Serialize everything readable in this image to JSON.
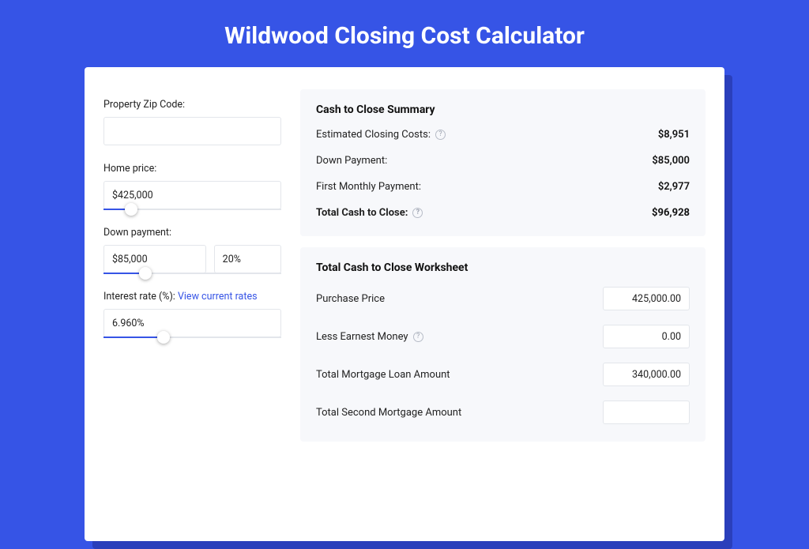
{
  "title": "Wildwood Closing Cost Calculator",
  "form": {
    "zip_label": "Property Zip Code:",
    "zip_value": "",
    "home_price_label": "Home price:",
    "home_price_value": "$425,000",
    "home_price_pct": 12,
    "down_payment_label": "Down payment:",
    "down_payment_value": "$85,000",
    "down_payment_pct_value": "20%",
    "down_payment_slider_pct": 20,
    "interest_label": "Interest rate (%): ",
    "interest_link": "View current rates",
    "interest_value": "6.960%",
    "interest_slider_pct": 30
  },
  "summary": {
    "heading": "Cash to Close Summary",
    "rows": [
      {
        "label": "Estimated Closing Costs:",
        "help": true,
        "value": "$8,951"
      },
      {
        "label": "Down Payment:",
        "help": false,
        "value": "$85,000"
      },
      {
        "label": "First Monthly Payment:",
        "help": false,
        "value": "$2,977"
      }
    ],
    "total": {
      "label": "Total Cash to Close:",
      "help": true,
      "value": "$96,928"
    }
  },
  "worksheet": {
    "heading": "Total Cash to Close Worksheet",
    "rows": [
      {
        "label": "Purchase Price",
        "help": false,
        "value": "425,000.00"
      },
      {
        "label": "Less Earnest Money",
        "help": true,
        "value": "0.00"
      },
      {
        "label": "Total Mortgage Loan Amount",
        "help": false,
        "value": "340,000.00"
      },
      {
        "label": "Total Second Mortgage Amount",
        "help": false,
        "value": ""
      }
    ]
  }
}
